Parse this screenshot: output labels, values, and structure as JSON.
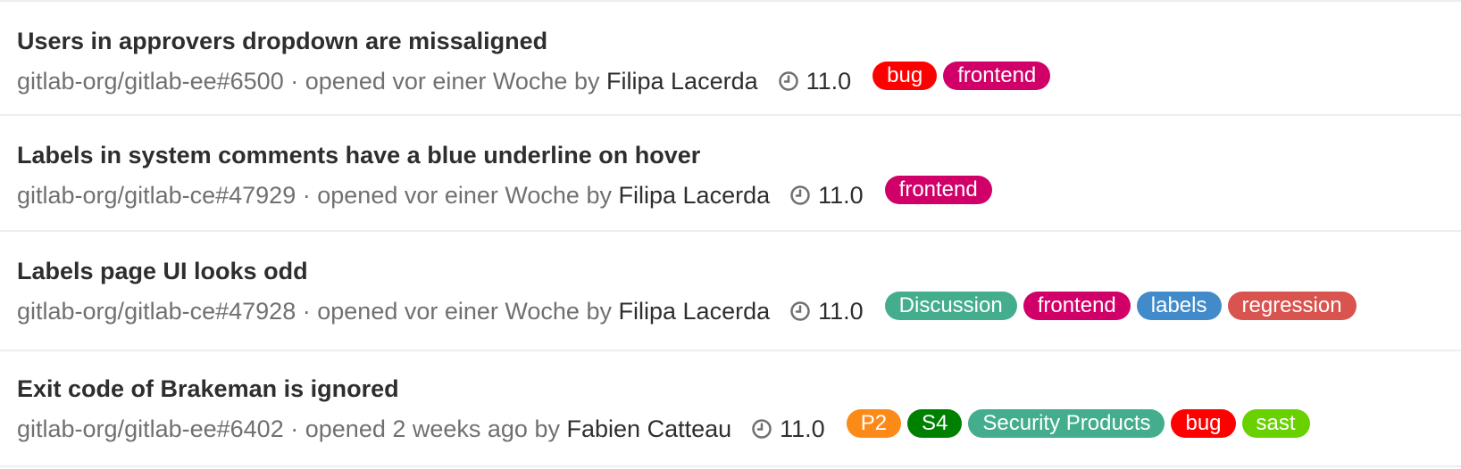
{
  "issues": [
    {
      "title": "Users in approvers dropdown are missaligned",
      "reference": "gitlab-org/gitlab-ee#6500",
      "separator": "·",
      "opened": "opened vor einer Woche",
      "by": "by",
      "author": "Filipa Lacerda",
      "milestone": "11.0",
      "milestone_icon": "clock-icon",
      "labels": [
        {
          "text": "bug",
          "color": "#ff0000"
        },
        {
          "text": "frontend",
          "color": "#d10069"
        }
      ]
    },
    {
      "title": "Labels in system comments have a blue underline on hover",
      "reference": "gitlab-org/gitlab-ce#47929",
      "separator": "·",
      "opened": "opened vor einer Woche",
      "by": "by",
      "author": "Filipa Lacerda",
      "milestone": "11.0",
      "milestone_icon": "clock-icon",
      "labels": [
        {
          "text": "frontend",
          "color": "#d10069"
        }
      ]
    },
    {
      "title": "Labels page UI looks odd",
      "reference": "gitlab-org/gitlab-ce#47928",
      "separator": "·",
      "opened": "opened vor einer Woche",
      "by": "by",
      "author": "Filipa Lacerda",
      "milestone": "11.0",
      "milestone_icon": "clock-icon",
      "labels": [
        {
          "text": "Discussion",
          "color": "#44ad8e"
        },
        {
          "text": "frontend",
          "color": "#d10069"
        },
        {
          "text": "labels",
          "color": "#428bca"
        },
        {
          "text": "regression",
          "color": "#d9534f"
        }
      ]
    },
    {
      "title": "Exit code of Brakeman is ignored",
      "reference": "gitlab-org/gitlab-ee#6402",
      "separator": "·",
      "opened": "opened 2 weeks ago",
      "by": "by",
      "author": "Fabien Catteau",
      "milestone": "11.0",
      "milestone_icon": "clock-icon",
      "labels": [
        {
          "text": "P2",
          "color": "#fc8a18"
        },
        {
          "text": "S4",
          "color": "#008000"
        },
        {
          "text": "Security Products",
          "color": "#44ad8e"
        },
        {
          "text": "bug",
          "color": "#ff0000"
        },
        {
          "text": "sast",
          "color": "#69d100"
        }
      ]
    }
  ]
}
